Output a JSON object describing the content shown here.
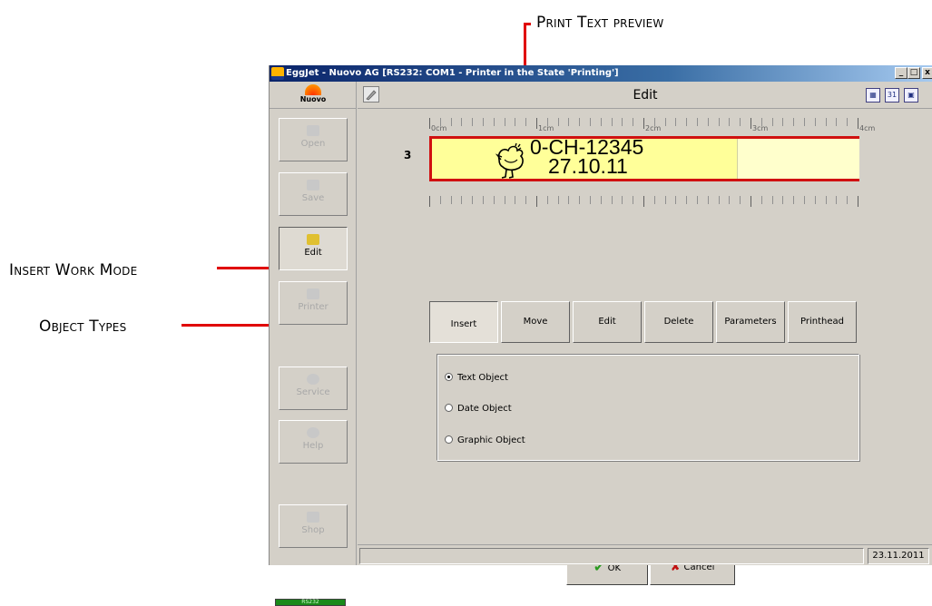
{
  "callouts": {
    "print_text_preview": "Print Text preview",
    "insert_work_mode": "Insert Work Mode",
    "object_types": "Object Types"
  },
  "window": {
    "title": "EggJet - Nuovo AG   [RS232: COM1 - Printer in the State 'Printing']",
    "minimize": "_",
    "maximize": "□",
    "close": "x"
  },
  "header": {
    "logo": "Nuovo",
    "title": "Edit"
  },
  "sidebar": {
    "items": [
      {
        "label": "Open",
        "icon": "folder-icon"
      },
      {
        "label": "Save",
        "icon": "save-icon"
      },
      {
        "label": "Edit",
        "icon": "edit-icon"
      },
      {
        "label": "Printer",
        "icon": "printer-icon"
      },
      {
        "label": "Service",
        "icon": "service-icon"
      },
      {
        "label": "Help",
        "icon": "help-icon"
      },
      {
        "label": "Shop",
        "icon": "shop-icon"
      }
    ],
    "active": "Edit",
    "connection": "RS232"
  },
  "ruler": {
    "labels": [
      "0cm",
      "1cm",
      "2cm",
      "3cm",
      "4cm"
    ]
  },
  "preview": {
    "row_number": "3",
    "line1": "0-CH-12345",
    "line2": "27.10.11"
  },
  "modes": {
    "buttons": [
      "Insert",
      "Move",
      "Edit",
      "Delete",
      "Parameters",
      "Printhead"
    ],
    "active": "Insert"
  },
  "object_types": {
    "options": [
      "Text Object",
      "Date Object",
      "Graphic Object"
    ],
    "selected": "Text Object"
  },
  "footer": {
    "ok": "OK",
    "cancel": "Cancel",
    "date": "23.11.2011"
  },
  "colors": {
    "annotation_red": "#e00000",
    "preview_bg": "#ffff99",
    "ok_check": "#2a9a20",
    "cancel_x": "#c01010"
  }
}
